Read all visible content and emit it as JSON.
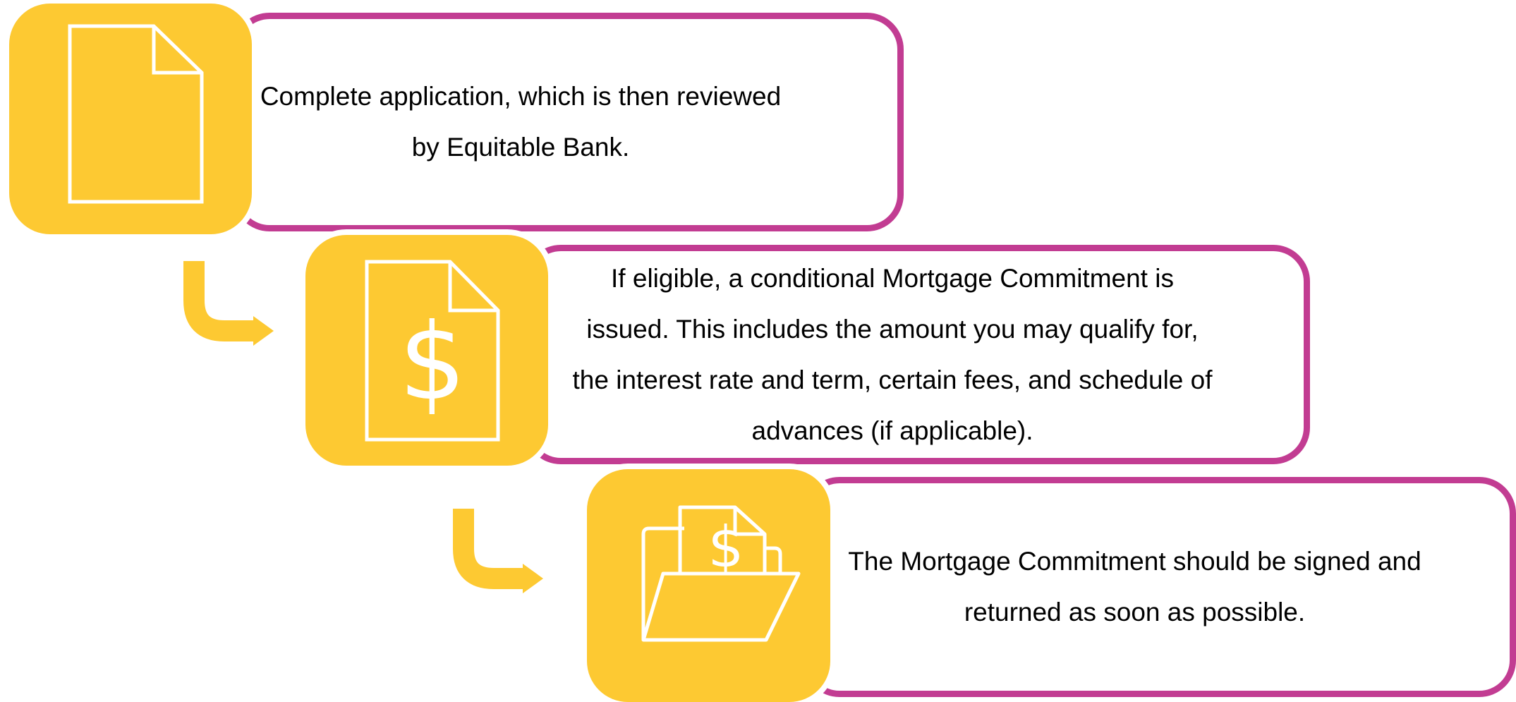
{
  "colors": {
    "accent": "#c23c92",
    "tile": "#fdc932",
    "icon_stroke": "#ffffff"
  },
  "steps": [
    {
      "icon": "document-icon",
      "text_lines": [
        "Complete application, which is then reviewed",
        "by Equitable Bank."
      ]
    },
    {
      "icon": "dollar-document-icon",
      "text_lines": [
        "If eligible, a conditional Mortgage Commitment is",
        "issued. This includes the amount you may qualify for,",
        "the interest rate and term, certain fees, and schedule of",
        "advances (if applicable)."
      ]
    },
    {
      "icon": "folder-dollar-icon",
      "text_lines": [
        "The Mortgage Commitment should be signed and",
        "returned as soon as possible."
      ]
    }
  ],
  "connectors": [
    {
      "icon": "turn-right-arrow-icon"
    },
    {
      "icon": "turn-right-arrow-icon"
    }
  ]
}
